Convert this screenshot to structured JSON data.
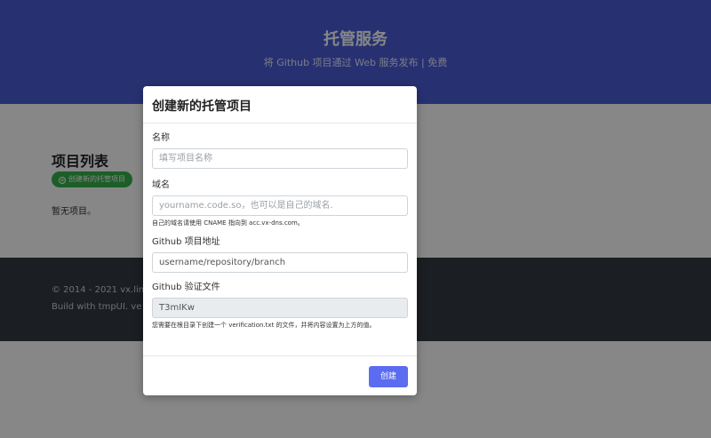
{
  "hero": {
    "title": "托管服务",
    "subtitle": "将 Github 项目通过 Web 服务发布 | 免费"
  },
  "main": {
    "list_title": "项目列表",
    "create_button_label": "创建新的托管项目",
    "empty_text": "暂无项目。"
  },
  "footer": {
    "copyright": "© 2014 - 2021 vx.lin",
    "build": "Build with tmpUI. ve"
  },
  "modal": {
    "title": "创建新的托管项目",
    "fields": {
      "name": {
        "label": "名称",
        "placeholder": "填写项目名称"
      },
      "domain": {
        "label": "域名",
        "placeholder": "yourname.code.so，也可以是自己的域名.",
        "hint": "自己的域名请使用 CNAME 指向到 acc.vx-dns.com。"
      },
      "repo": {
        "label": "Github 项目地址",
        "value": "username/repository/branch"
      },
      "verify": {
        "label": "Github 验证文件",
        "value": "T3mIKw",
        "hint": "您需要在根目录下创建一个 verification.txt 的文件，并将内容设置为上方的值。"
      }
    },
    "submit_label": "创建"
  },
  "colors": {
    "hero_bg": "#4a5ed8",
    "footer_bg": "#343a40",
    "create_button": "#37b24d",
    "submit_button": "#5b6cf0"
  },
  "icons": {
    "create_button_icon": "plus-circle-icon"
  }
}
